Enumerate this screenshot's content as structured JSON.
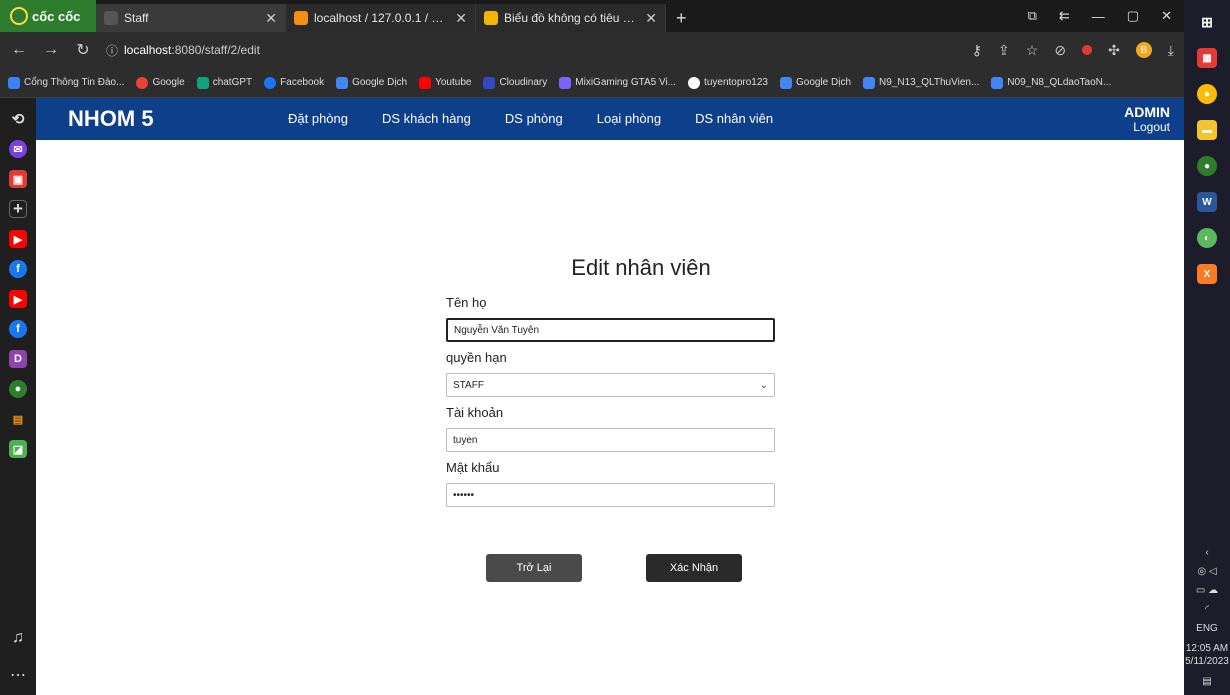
{
  "browser": {
    "brand": "cốc cốc",
    "tabs": [
      {
        "title": "Staff",
        "active": true,
        "color": "#555555"
      },
      {
        "title": "localhost / 127.0.0.1 / hms /",
        "active": false,
        "color": "#f29111"
      },
      {
        "title": "Biểu đồ không có tiêu đề - ",
        "active": false,
        "color": "#f4b400"
      }
    ],
    "url_host": "localhost",
    "url_rest": ":8080/staff/2/edit",
    "bookmarks": [
      {
        "label": "Cổng Thông Tin Đào...",
        "color": "#3b82f6"
      },
      {
        "label": "Google",
        "color": "#ea4335"
      },
      {
        "label": "chatGPT",
        "color": "#10a37f"
      },
      {
        "label": "Facebook",
        "color": "#1877f2"
      },
      {
        "label": "Google Dịch",
        "color": "#4285f4"
      },
      {
        "label": "Youtube",
        "color": "#ff0000"
      },
      {
        "label": "Cloudinary",
        "color": "#3448c5"
      },
      {
        "label": "MixiGaming GTA5 Vi...",
        "color": "#7b61ff"
      },
      {
        "label": "tuyentopro123",
        "color": "#ffffff"
      },
      {
        "label": "Google Dịch",
        "color": "#4285f4"
      },
      {
        "label": "N9_N13_QLThuVien...",
        "color": "#4285f4"
      },
      {
        "label": "N09_N8_QLdaoTaoN...",
        "color": "#4285f4"
      }
    ]
  },
  "app": {
    "logo": "NHOM 5",
    "nav": [
      "Đặt phòng",
      "DS khách hàng",
      "DS phòng",
      "Loại phòng",
      "DS nhân viên"
    ],
    "user": "ADMIN",
    "logout": "Logout"
  },
  "form": {
    "title": "Edit nhân viên",
    "name_label": "Tên họ",
    "name_value": "Nguyễn Văn Tuyên",
    "role_label": "quyền hạn",
    "role_value": "STAFF",
    "account_label": "Tài khoản",
    "account_value": "tuyen",
    "password_label": "Mật khẩu",
    "password_value": "••••••",
    "back_button": "Trở Lại",
    "confirm_button": "Xác Nhận"
  },
  "tray": {
    "lang": "ENG",
    "time": "12:05 AM",
    "date": "5/11/2023"
  }
}
